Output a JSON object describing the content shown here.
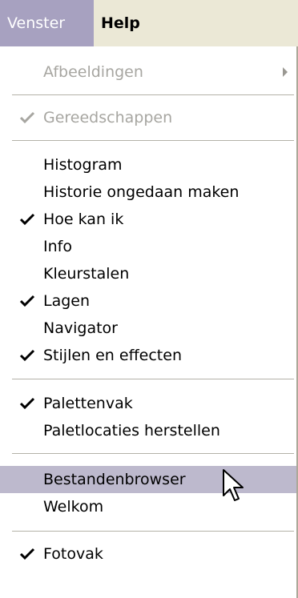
{
  "menubar": {
    "items": [
      {
        "label": "Venster",
        "state": "open"
      },
      {
        "label": "Help"
      }
    ]
  },
  "menu": {
    "items": [
      {
        "label": "Afbeeldingen",
        "enabled": false,
        "checked": false,
        "submenu": true
      },
      {
        "label": "Gereedschappen",
        "enabled": false,
        "checked": true
      },
      {
        "label": "Histogram",
        "enabled": true,
        "checked": false
      },
      {
        "label": "Historie ongedaan maken",
        "enabled": true,
        "checked": false
      },
      {
        "label": "Hoe kan ik",
        "enabled": true,
        "checked": true
      },
      {
        "label": "Info",
        "enabled": true,
        "checked": false
      },
      {
        "label": "Kleurstalen",
        "enabled": true,
        "checked": false
      },
      {
        "label": "Lagen",
        "enabled": true,
        "checked": true
      },
      {
        "label": "Navigator",
        "enabled": true,
        "checked": false
      },
      {
        "label": "Stijlen en effecten",
        "enabled": true,
        "checked": true
      },
      {
        "label": "Palettenvak",
        "enabled": true,
        "checked": true
      },
      {
        "label": "Paletlocaties herstellen",
        "enabled": true,
        "checked": false
      },
      {
        "label": "Bestandenbrowser",
        "enabled": true,
        "checked": false,
        "highlighted": true
      },
      {
        "label": "Welkom",
        "enabled": true,
        "checked": false
      },
      {
        "label": "Fotovak",
        "enabled": true,
        "checked": true
      }
    ]
  },
  "colors": {
    "menubar_bg": "#ebe8d6",
    "menubar_active": "#a7a1c0",
    "highlight": "#bdb9cd",
    "disabled_text": "#a7a6a1"
  },
  "icons": {
    "checkmark": "checkmark-icon",
    "submenu": "submenu-arrow-icon",
    "cursor": "mouse-pointer-icon"
  }
}
